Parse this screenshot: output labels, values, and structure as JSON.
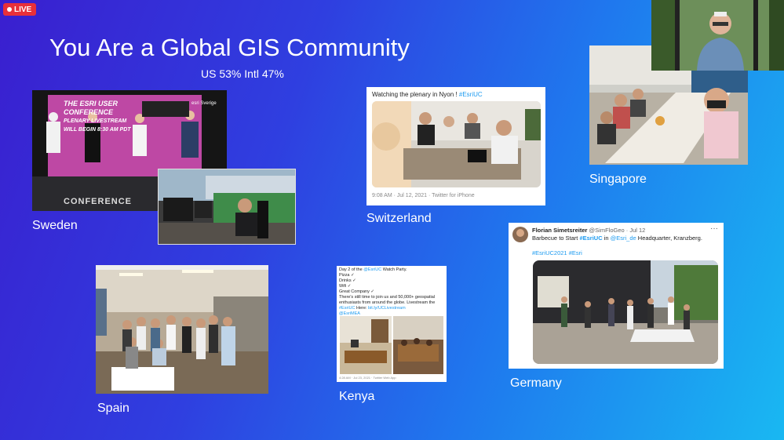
{
  "live_badge": "LIVE",
  "title": "You Are a Global GIS Community",
  "stats": "US 53%  Intl 47%",
  "regions": {
    "sweden": "Sweden",
    "switzerland": "Switzerland",
    "singapore": "Singapore",
    "spain": "Spain",
    "kenya": "Kenya",
    "germany": "Germany"
  },
  "sweden_screen": {
    "line1": "THE ESRI USER",
    "line2": "CONFERENCE",
    "line3": "PLENARY LIVESTREAM",
    "line4": "WILL BEGIN 8:30 AM PDT",
    "brand": "esri Sverige",
    "floor_text": "CONFERENCE"
  },
  "switzerland_tweet": {
    "text": "Watching the plenary in Nyon ! ",
    "hashtag": "#EsriUC",
    "meta": "9:08 AM · Jul 12, 2021 · Twitter for iPhone"
  },
  "kenya_tweet": {
    "l1a": "Day 2 of the ",
    "l1b": "@EsriUC",
    "l1c": " Watch Party.",
    "l2": "Pizza ✓",
    "l3": "Drinks ✓",
    "l4": "Wifi ✓",
    "l5": "Great Company ✓",
    "l6": "There's still time to join us and 50,000+ geospatial",
    "l7": "enthusiasts from around the globe.  Livestream the",
    "l8a": "#EsriUC",
    "l8b": " Here: ",
    "l8c": "bit.ly/UCLivestream",
    "l9": "@EsriMEA",
    "meta": "4:28 AM · Jul 23, 2021 · Twitter Web App"
  },
  "germany_tweet": {
    "name": "Florian Simetsreiter",
    "handle": "@SimFloGeo · Jul 12",
    "more": "···",
    "t1": "Barbecue to Start ",
    "t2": "#EsriUC",
    "t3": " in ",
    "t4": "@Esri_de",
    "t5": " Headquarter, Kranzberg.",
    "tags": "#EsriUC2021 #Esri"
  }
}
